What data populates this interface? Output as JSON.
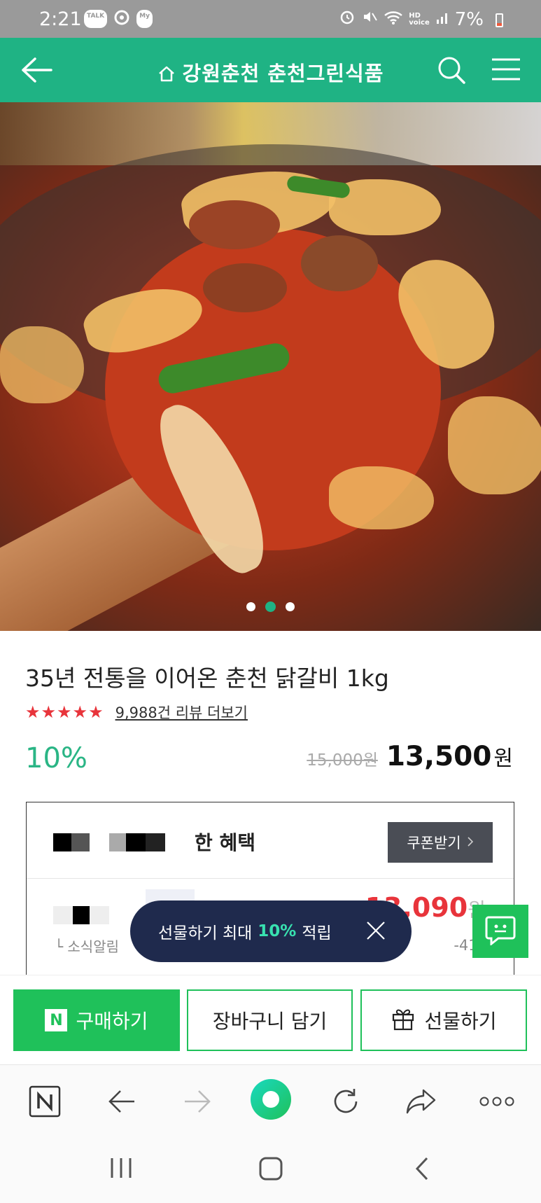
{
  "status_bar": {
    "time": "2:21",
    "left_icons": [
      "TALK",
      "My"
    ],
    "battery": "7%"
  },
  "header": {
    "title": "강원춘천 춘천그린식품"
  },
  "product": {
    "title": "35년 전통을 이어온 춘천 닭갈비 1kg",
    "stars": "★★★★★",
    "rating": 4.5,
    "review_link": "9,988건 리뷰 더보기",
    "discount": "10%",
    "original_price": "15,000원",
    "final_price": "13,500",
    "currency": "원",
    "image_count": 3,
    "image_index": 2
  },
  "benefit": {
    "title": "한 혜택",
    "coupon_button": "쿠폰받기",
    "coupon_price": "13,090",
    "coupon_currency": "원",
    "sub_label": "소식알림",
    "sub_amount": "-410"
  },
  "toast": {
    "prefix": "선물하기 최대",
    "highlight": "10%",
    "suffix": "적립"
  },
  "actions": {
    "buy": "구매하기",
    "buy_logo": "N",
    "cart": "장바구니 담기",
    "gift": "선물하기"
  },
  "colors": {
    "header_green": "#1fb384",
    "naver_green": "#1fc15a",
    "discount_green": "#2ab585",
    "price_red": "#e8343b",
    "toast_navy": "#1f2a4d"
  }
}
